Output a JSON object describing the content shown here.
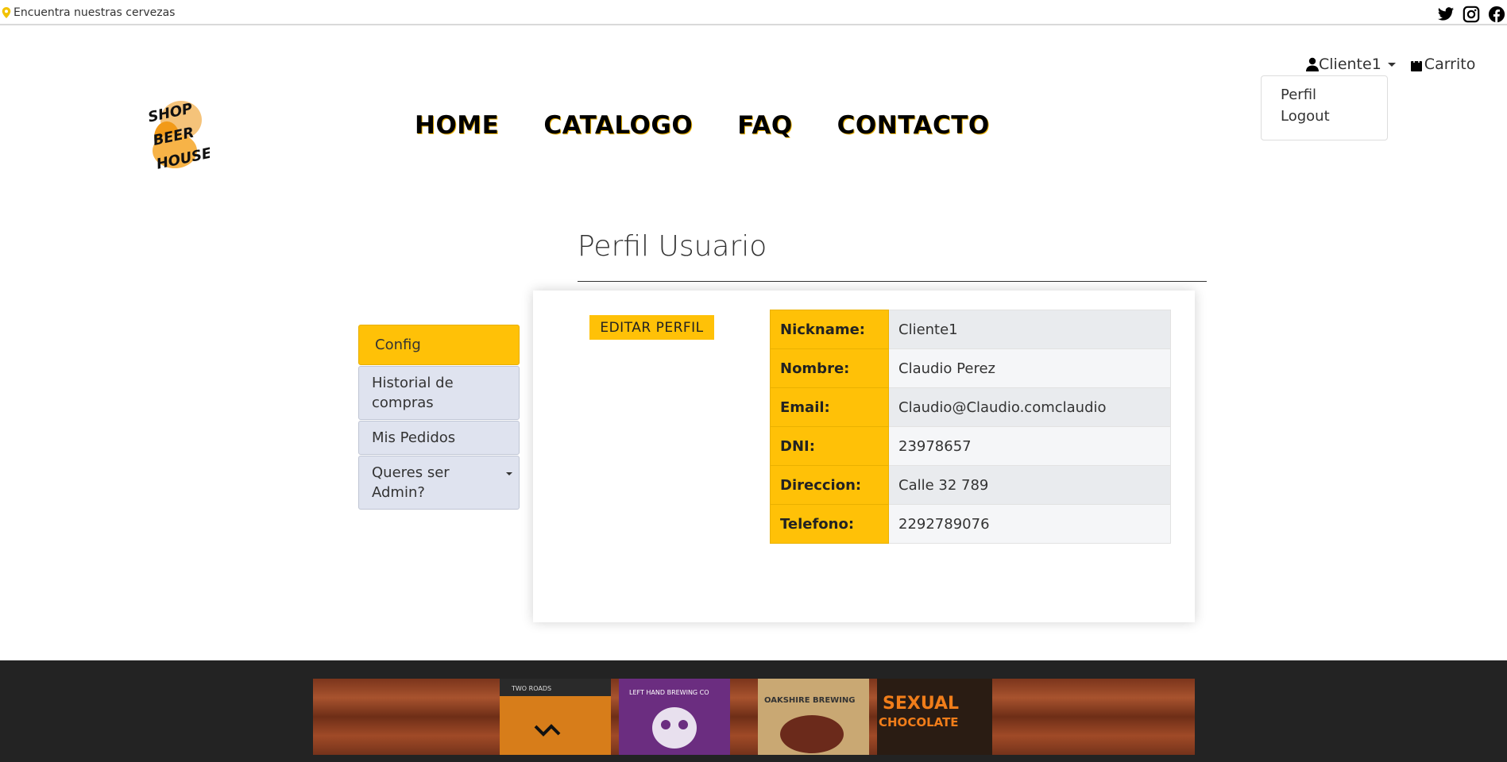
{
  "topbar": {
    "location_text": "Encuentra nuestras cervezas",
    "social_icons": [
      "twitter-icon",
      "instagram-icon",
      "facebook-icon"
    ]
  },
  "user_nav": {
    "user_label": "Cliente1",
    "cart_label": "Carrito",
    "dropdown_items": [
      "Perfil",
      "Logout"
    ]
  },
  "logo": {
    "text": [
      "SHOP",
      "BEER",
      "HOUSE"
    ]
  },
  "main_nav": {
    "items": [
      "HOME",
      "CATALOGO",
      "FAQ",
      "CONTACTO"
    ]
  },
  "page": {
    "title": "Perfil Usuario",
    "edit_button": "EDITAR PERFIL"
  },
  "sidebar": {
    "items": [
      {
        "label": "Config",
        "active": true
      },
      {
        "label": "Historial de compras"
      },
      {
        "label": "Mis Pedidos"
      },
      {
        "label": "Queres ser Admin?",
        "dropdown": true
      }
    ]
  },
  "profile": {
    "rows": [
      {
        "key": "Nickname:",
        "value": "Cliente1"
      },
      {
        "key": "Nombre:",
        "value": "Claudio Perez"
      },
      {
        "key": "Email:",
        "value": "Claudio@Claudio.comclaudio"
      },
      {
        "key": "DNI:",
        "value": "23978657"
      },
      {
        "key": "Direccion:",
        "value": "Calle 32 789"
      },
      {
        "key": "Telefono:",
        "value": "2292789076"
      }
    ]
  },
  "footer": {
    "banner_labels": [
      "TWO ROADS",
      "LEFT HAND BREWING CO",
      "OAKSHIRE BREWING",
      "SEXUAL CHOCOLATE"
    ]
  },
  "colors": {
    "accent": "#ffc107",
    "footer_bg": "#232323",
    "sidebar_bg": "#dfe3ef"
  }
}
